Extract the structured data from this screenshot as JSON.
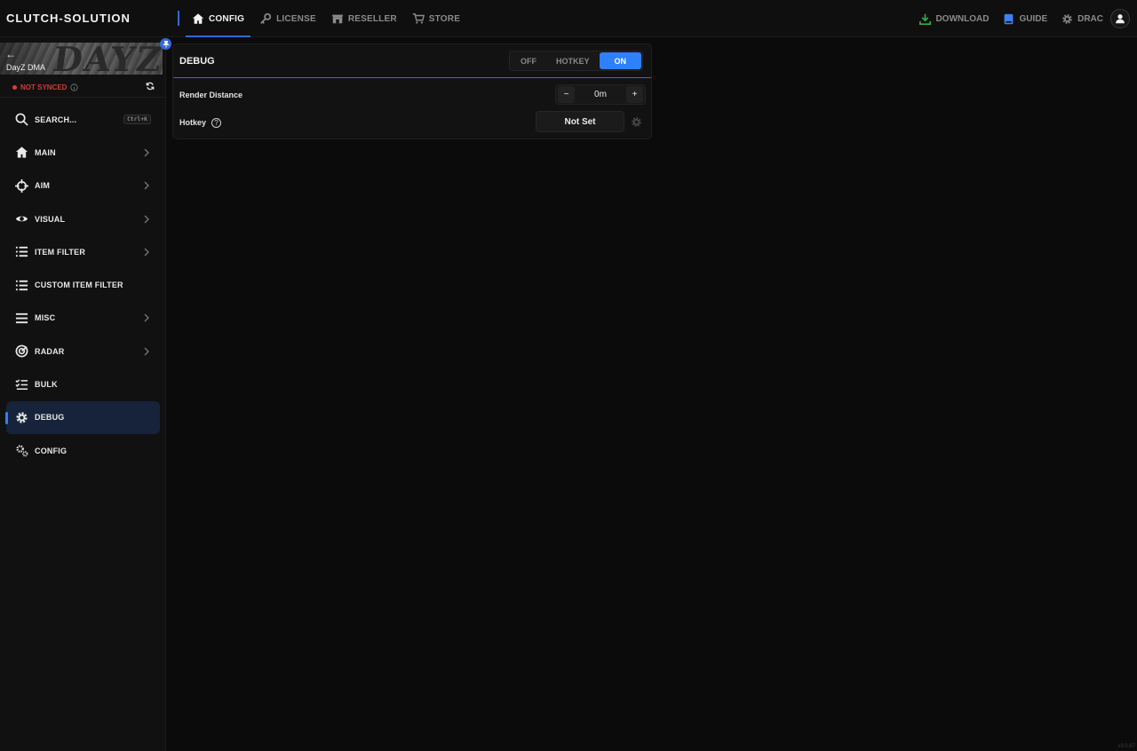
{
  "app": {
    "brand": "CLUTCH-SOLUTION",
    "version": "v3.0.67"
  },
  "nav": [
    {
      "label": "CONFIG",
      "icon": "home-icon",
      "active": true
    },
    {
      "label": "LICENSE",
      "icon": "key-icon"
    },
    {
      "label": "RESELLER",
      "icon": "store-icon"
    },
    {
      "label": "STORE",
      "icon": "cart-icon"
    }
  ],
  "top_right": {
    "download": "DOWNLOAD",
    "guide": "GUIDE",
    "user": "DRAC"
  },
  "colors": {
    "accent": "#2f80ff",
    "download": "#2fae4a",
    "guide": "#3b82f6",
    "error": "#e23b3b"
  },
  "sidebar": {
    "banner_title": "DayZ DMA",
    "banner_logo": "DAYZ",
    "sync_status": "NOT SYNCED",
    "search_label": "SEARCH...",
    "search_shortcut": "Ctrl+K",
    "items": [
      {
        "label": "MAIN",
        "icon": "home-icon",
        "chevron": true
      },
      {
        "label": "AIM",
        "icon": "crosshair-icon",
        "chevron": true
      },
      {
        "label": "VISUAL",
        "icon": "eye-icon",
        "chevron": true
      },
      {
        "label": "ITEM FILTER",
        "icon": "list-icon",
        "chevron": true
      },
      {
        "label": "CUSTOM ITEM FILTER",
        "icon": "list-icon",
        "chevron": false
      },
      {
        "label": "MISC",
        "icon": "menu-icon",
        "chevron": true
      },
      {
        "label": "RADAR",
        "icon": "radar-icon",
        "chevron": true
      },
      {
        "label": "BULK",
        "icon": "checklist-icon",
        "chevron": false
      },
      {
        "label": "DEBUG",
        "icon": "gear-icon",
        "chevron": false,
        "active": true
      },
      {
        "label": "CONFIG",
        "icon": "gears-icon",
        "chevron": false
      }
    ]
  },
  "panel": {
    "title": "DEBUG",
    "modes": [
      "OFF",
      "HOTKEY",
      "ON"
    ],
    "selected_mode": "ON",
    "render_distance": {
      "label": "Render Distance",
      "value": "0m",
      "minus": "−",
      "plus": "+"
    },
    "hotkey": {
      "label": "Hotkey",
      "help": "?",
      "value": "Not Set"
    }
  }
}
